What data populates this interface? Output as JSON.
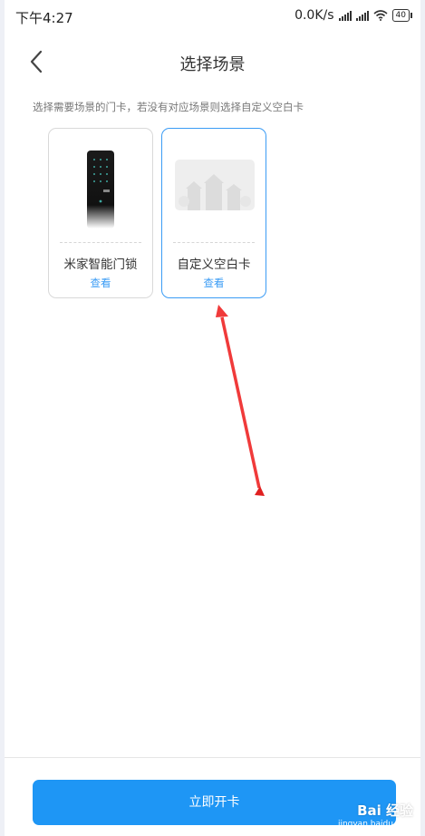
{
  "status_bar": {
    "time": "下午4:27",
    "network_speed": "0.0K/s",
    "battery": "40"
  },
  "header": {
    "title": "选择场景"
  },
  "hint": "选择需要场景的门卡，若没有对应场景则选择自定义空白卡",
  "cards": [
    {
      "name": "米家智能门锁",
      "action": "查看",
      "selected": false,
      "icon": "door-lock-icon"
    },
    {
      "name": "自定义空白卡",
      "action": "查看",
      "selected": true,
      "icon": "blank-card-icon"
    }
  ],
  "footer": {
    "button_label": "立即开卡"
  },
  "watermark": {
    "brand": "Bai 经验",
    "url": "jingyan.baidu.com"
  },
  "colors": {
    "accent": "#1e96f5",
    "arrow": "#f03a3a",
    "selected_border": "#3b9cf5"
  }
}
